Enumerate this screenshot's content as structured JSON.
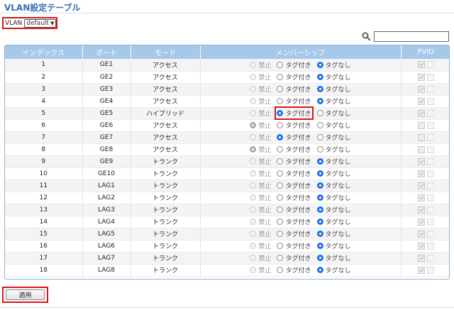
{
  "page": {
    "title": "VLAN設定テーブル"
  },
  "vlan": {
    "label": "VLAN",
    "selected": "default"
  },
  "search": {
    "placeholder": ""
  },
  "table": {
    "headers": {
      "index": "インデックス",
      "port": "ポート",
      "mode": "モード",
      "membership": "メンバーシップ",
      "pvid": "PVID"
    },
    "options": {
      "forbidden": "禁止",
      "tagged": "タグ付き",
      "untagged": "タグなし"
    },
    "rows": [
      {
        "index": "1",
        "port": "GE1",
        "mode": "アクセス",
        "member": "untagged",
        "pvid": true
      },
      {
        "index": "2",
        "port": "GE2",
        "mode": "アクセス",
        "member": "untagged",
        "pvid": true
      },
      {
        "index": "3",
        "port": "GE3",
        "mode": "アクセス",
        "member": "untagged",
        "pvid": true
      },
      {
        "index": "4",
        "port": "GE4",
        "mode": "アクセス",
        "member": "untagged",
        "pvid": true
      },
      {
        "index": "5",
        "port": "GE5",
        "mode": "ハイブリッド",
        "member": "tagged",
        "pvid": true,
        "highlight": true
      },
      {
        "index": "6",
        "port": "GE6",
        "mode": "アクセス",
        "member": "forbidden",
        "pvid": false
      },
      {
        "index": "7",
        "port": "GE7",
        "mode": "アクセス",
        "member": "tagged",
        "pvid": false
      },
      {
        "index": "8",
        "port": "GE8",
        "mode": "アクセス",
        "member": "forbidden",
        "pvid": false
      },
      {
        "index": "9",
        "port": "GE9",
        "mode": "トランク",
        "member": "untagged",
        "pvid": true
      },
      {
        "index": "10",
        "port": "GE10",
        "mode": "トランク",
        "member": "untagged",
        "pvid": true
      },
      {
        "index": "11",
        "port": "LAG1",
        "mode": "トランク",
        "member": "untagged",
        "pvid": true
      },
      {
        "index": "12",
        "port": "LAG2",
        "mode": "トランク",
        "member": "untagged",
        "pvid": true
      },
      {
        "index": "13",
        "port": "LAG3",
        "mode": "トランク",
        "member": "untagged",
        "pvid": true
      },
      {
        "index": "14",
        "port": "LAG4",
        "mode": "トランク",
        "member": "untagged",
        "pvid": true
      },
      {
        "index": "15",
        "port": "LAG5",
        "mode": "トランク",
        "member": "untagged",
        "pvid": true
      },
      {
        "index": "16",
        "port": "LAG6",
        "mode": "トランク",
        "member": "untagged",
        "pvid": true
      },
      {
        "index": "17",
        "port": "LAG7",
        "mode": "トランク",
        "member": "untagged",
        "pvid": true
      },
      {
        "index": "18",
        "port": "LAG8",
        "mode": "トランク",
        "member": "untagged",
        "pvid": true
      }
    ]
  },
  "apply": {
    "label": "適用"
  },
  "colors": {
    "title": "#3a6fb0",
    "header_bg": "#a6c8ea",
    "highlight": "#d9141b",
    "radio_selected": "#1a73e8"
  }
}
